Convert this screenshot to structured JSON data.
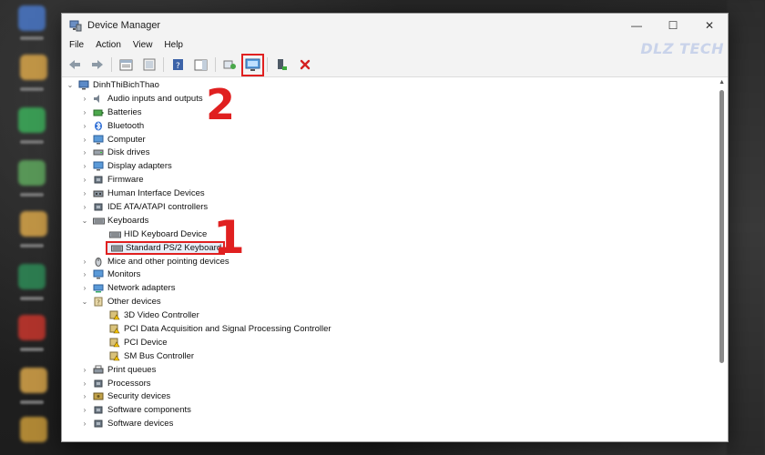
{
  "window": {
    "title": "Device Manager",
    "minimize_glyph": "—",
    "maximize_glyph": "☐",
    "close_glyph": "✕"
  },
  "menu": {
    "items": [
      "File",
      "Action",
      "View",
      "Help"
    ]
  },
  "toolbar": {
    "watermark": "DLZ TECH",
    "buttons": [
      "back-icon",
      "forward-icon",
      "properties-window-icon",
      "show-hidden-icon",
      "help-icon",
      "action-pane-icon",
      "scan-hardware-icon",
      "update-driver-icon",
      "enable-device-icon",
      "uninstall-device-icon"
    ]
  },
  "annotations": {
    "step1": "1",
    "step2": "2"
  },
  "tree": {
    "root": "DinhThiBichThao",
    "items": [
      {
        "label": "Audio inputs and outputs",
        "level": 1,
        "arrow": "›",
        "icon": "speaker"
      },
      {
        "label": "Batteries",
        "level": 1,
        "arrow": "›",
        "icon": "battery"
      },
      {
        "label": "Bluetooth",
        "level": 1,
        "arrow": "›",
        "icon": "bluetooth"
      },
      {
        "label": "Computer",
        "level": 1,
        "arrow": "›",
        "icon": "monitor"
      },
      {
        "label": "Disk drives",
        "level": 1,
        "arrow": "›",
        "icon": "disk"
      },
      {
        "label": "Display adapters",
        "level": 1,
        "arrow": "›",
        "icon": "monitor"
      },
      {
        "label": "Firmware",
        "level": 1,
        "arrow": "›",
        "icon": "chip"
      },
      {
        "label": "Human Interface Devices",
        "level": 1,
        "arrow": "›",
        "icon": "hid"
      },
      {
        "label": "IDE ATA/ATAPI controllers",
        "level": 1,
        "arrow": "›",
        "icon": "chip"
      },
      {
        "label": "Keyboards",
        "level": 1,
        "arrow": "⌄",
        "icon": "keyboard"
      },
      {
        "label": "HID Keyboard Device",
        "level": 2,
        "arrow": "",
        "icon": "keyboard"
      },
      {
        "label": "Standard PS/2 Keyboard",
        "level": 2,
        "arrow": "",
        "icon": "keyboard",
        "selected": true
      },
      {
        "label": "Mice and other pointing devices",
        "level": 1,
        "arrow": "›",
        "icon": "mouse"
      },
      {
        "label": "Monitors",
        "level": 1,
        "arrow": "›",
        "icon": "monitor"
      },
      {
        "label": "Network adapters",
        "level": 1,
        "arrow": "›",
        "icon": "network"
      },
      {
        "label": "Other devices",
        "level": 1,
        "arrow": "⌄",
        "icon": "other"
      },
      {
        "label": "3D Video Controller",
        "level": 2,
        "arrow": "",
        "icon": "warning"
      },
      {
        "label": "PCI Data Acquisition and Signal Processing Controller",
        "level": 2,
        "arrow": "",
        "icon": "warning"
      },
      {
        "label": "PCI Device",
        "level": 2,
        "arrow": "",
        "icon": "warning"
      },
      {
        "label": "SM Bus Controller",
        "level": 2,
        "arrow": "",
        "icon": "warning"
      },
      {
        "label": "Print queues",
        "level": 1,
        "arrow": "›",
        "icon": "printer"
      },
      {
        "label": "Processors",
        "level": 1,
        "arrow": "›",
        "icon": "chip"
      },
      {
        "label": "Security devices",
        "level": 1,
        "arrow": "›",
        "icon": "security"
      },
      {
        "label": "Software components",
        "level": 1,
        "arrow": "›",
        "icon": "chip"
      },
      {
        "label": "Software devices",
        "level": 1,
        "arrow": "›",
        "icon": "chip"
      }
    ]
  },
  "colors": {
    "annotation_red": "#e02020",
    "window_bg": "#ffffff",
    "chrome_bg": "#f3f3f3"
  }
}
